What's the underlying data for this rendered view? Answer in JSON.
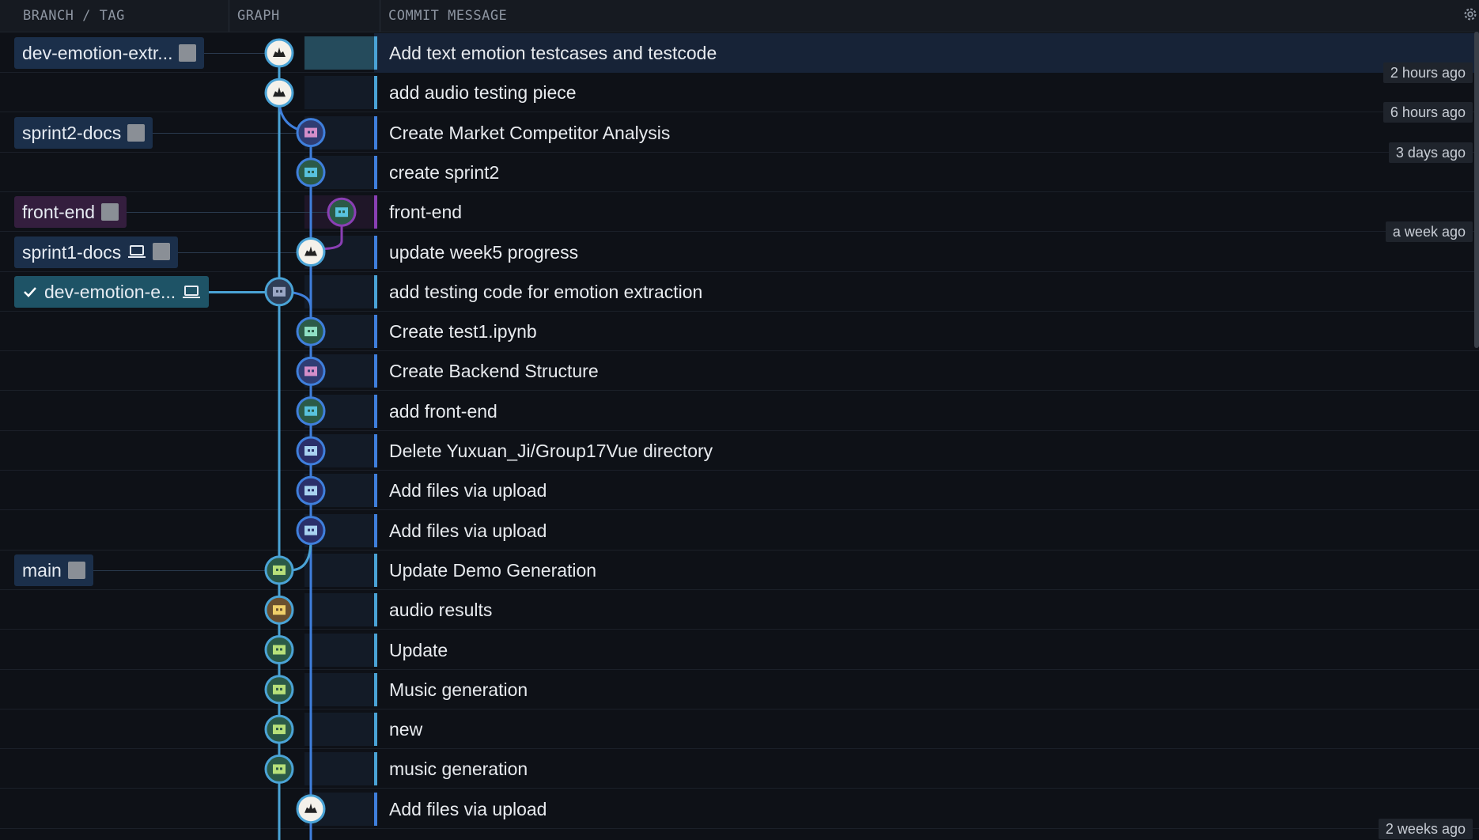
{
  "header": {
    "branch_tag": "BRANCH / TAG",
    "graph": "GRAPH",
    "commit_message": "COMMIT MESSAGE",
    "settings_icon": "gear-icon"
  },
  "commits": [
    {
      "message": "Add text emotion testcases and testcode",
      "selected": true
    },
    {
      "message": "add audio testing piece"
    },
    {
      "message": "Create Market Competitor Analysis"
    },
    {
      "message": "create sprint2"
    },
    {
      "message": "front-end"
    },
    {
      "message": "update week5 progress"
    },
    {
      "message": "add testing code for emotion extraction"
    },
    {
      "message": "Create test1.ipynb"
    },
    {
      "message": "Create Backend Structure"
    },
    {
      "message": "add front-end"
    },
    {
      "message": "Delete Yuxuan_Ji/Group17Vue directory"
    },
    {
      "message": "Add files via upload"
    },
    {
      "message": "Add files via upload"
    },
    {
      "message": "Update Demo Generation"
    },
    {
      "message": "audio results"
    },
    {
      "message": "Update"
    },
    {
      "message": "Music generation"
    },
    {
      "message": "new"
    },
    {
      "message": "music generation"
    },
    {
      "message": "Add files via upload"
    }
  ],
  "branches": [
    {
      "label": "dev-emotion-extr...",
      "row": 0,
      "style": "blue",
      "icons": [
        "avatar"
      ]
    },
    {
      "label": "sprint2-docs",
      "row": 2,
      "style": "blue",
      "icons": [
        "avatar"
      ]
    },
    {
      "label": "front-end",
      "row": 4,
      "style": "purple",
      "icons": [
        "avatar"
      ]
    },
    {
      "label": "sprint1-docs",
      "row": 5,
      "style": "blue",
      "icons": [
        "laptop-icon",
        "avatar"
      ]
    },
    {
      "label": "dev-emotion-e...",
      "row": 6,
      "style": "teal",
      "checked": true,
      "icons": [
        "laptop-icon"
      ]
    },
    {
      "label": "main",
      "row": 13,
      "style": "blue",
      "icons": [
        "avatar"
      ]
    }
  ],
  "timestamps": [
    {
      "label": "2 hours ago",
      "after_row": 0
    },
    {
      "label": "6 hours ago",
      "after_row": 1
    },
    {
      "label": "3 days ago",
      "after_row": 2
    },
    {
      "label": "a week ago",
      "after_row": 4
    },
    {
      "label": "2 weeks ago",
      "after_row": 20
    }
  ],
  "colors": {
    "lane_main": "#4aa3d6",
    "lane_blue": "#3f7fdc",
    "lane_purple": "#8a3fb4",
    "selected_row": "#172337",
    "background": "#0e1117"
  }
}
